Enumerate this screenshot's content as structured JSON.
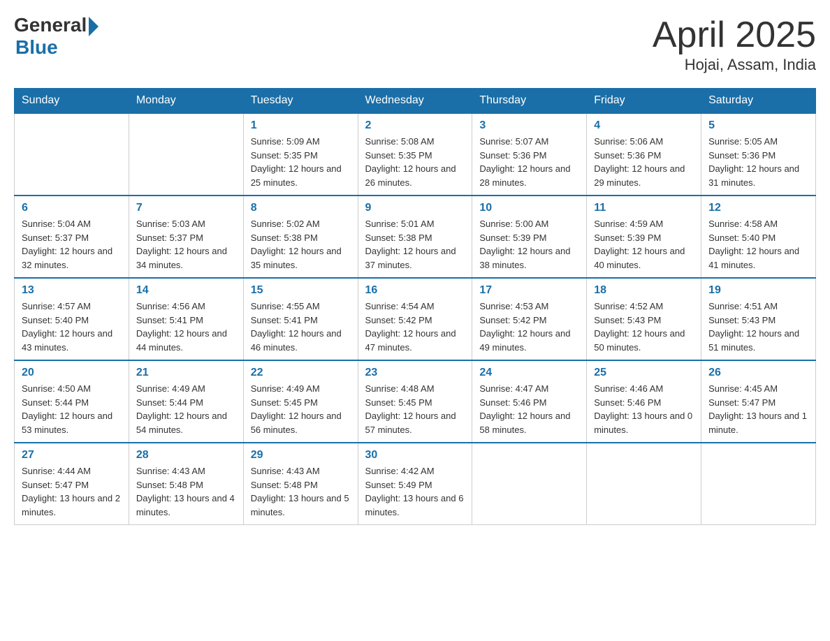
{
  "header": {
    "logo_general": "General",
    "logo_blue": "Blue",
    "title": "April 2025",
    "subtitle": "Hojai, Assam, India"
  },
  "days_of_week": [
    "Sunday",
    "Monday",
    "Tuesday",
    "Wednesday",
    "Thursday",
    "Friday",
    "Saturday"
  ],
  "weeks": [
    [
      {
        "day": "",
        "info": ""
      },
      {
        "day": "",
        "info": ""
      },
      {
        "day": "1",
        "info": "Sunrise: 5:09 AM\nSunset: 5:35 PM\nDaylight: 12 hours\nand 25 minutes."
      },
      {
        "day": "2",
        "info": "Sunrise: 5:08 AM\nSunset: 5:35 PM\nDaylight: 12 hours\nand 26 minutes."
      },
      {
        "day": "3",
        "info": "Sunrise: 5:07 AM\nSunset: 5:36 PM\nDaylight: 12 hours\nand 28 minutes."
      },
      {
        "day": "4",
        "info": "Sunrise: 5:06 AM\nSunset: 5:36 PM\nDaylight: 12 hours\nand 29 minutes."
      },
      {
        "day": "5",
        "info": "Sunrise: 5:05 AM\nSunset: 5:36 PM\nDaylight: 12 hours\nand 31 minutes."
      }
    ],
    [
      {
        "day": "6",
        "info": "Sunrise: 5:04 AM\nSunset: 5:37 PM\nDaylight: 12 hours\nand 32 minutes."
      },
      {
        "day": "7",
        "info": "Sunrise: 5:03 AM\nSunset: 5:37 PM\nDaylight: 12 hours\nand 34 minutes."
      },
      {
        "day": "8",
        "info": "Sunrise: 5:02 AM\nSunset: 5:38 PM\nDaylight: 12 hours\nand 35 minutes."
      },
      {
        "day": "9",
        "info": "Sunrise: 5:01 AM\nSunset: 5:38 PM\nDaylight: 12 hours\nand 37 minutes."
      },
      {
        "day": "10",
        "info": "Sunrise: 5:00 AM\nSunset: 5:39 PM\nDaylight: 12 hours\nand 38 minutes."
      },
      {
        "day": "11",
        "info": "Sunrise: 4:59 AM\nSunset: 5:39 PM\nDaylight: 12 hours\nand 40 minutes."
      },
      {
        "day": "12",
        "info": "Sunrise: 4:58 AM\nSunset: 5:40 PM\nDaylight: 12 hours\nand 41 minutes."
      }
    ],
    [
      {
        "day": "13",
        "info": "Sunrise: 4:57 AM\nSunset: 5:40 PM\nDaylight: 12 hours\nand 43 minutes."
      },
      {
        "day": "14",
        "info": "Sunrise: 4:56 AM\nSunset: 5:41 PM\nDaylight: 12 hours\nand 44 minutes."
      },
      {
        "day": "15",
        "info": "Sunrise: 4:55 AM\nSunset: 5:41 PM\nDaylight: 12 hours\nand 46 minutes."
      },
      {
        "day": "16",
        "info": "Sunrise: 4:54 AM\nSunset: 5:42 PM\nDaylight: 12 hours\nand 47 minutes."
      },
      {
        "day": "17",
        "info": "Sunrise: 4:53 AM\nSunset: 5:42 PM\nDaylight: 12 hours\nand 49 minutes."
      },
      {
        "day": "18",
        "info": "Sunrise: 4:52 AM\nSunset: 5:43 PM\nDaylight: 12 hours\nand 50 minutes."
      },
      {
        "day": "19",
        "info": "Sunrise: 4:51 AM\nSunset: 5:43 PM\nDaylight: 12 hours\nand 51 minutes."
      }
    ],
    [
      {
        "day": "20",
        "info": "Sunrise: 4:50 AM\nSunset: 5:44 PM\nDaylight: 12 hours\nand 53 minutes."
      },
      {
        "day": "21",
        "info": "Sunrise: 4:49 AM\nSunset: 5:44 PM\nDaylight: 12 hours\nand 54 minutes."
      },
      {
        "day": "22",
        "info": "Sunrise: 4:49 AM\nSunset: 5:45 PM\nDaylight: 12 hours\nand 56 minutes."
      },
      {
        "day": "23",
        "info": "Sunrise: 4:48 AM\nSunset: 5:45 PM\nDaylight: 12 hours\nand 57 minutes."
      },
      {
        "day": "24",
        "info": "Sunrise: 4:47 AM\nSunset: 5:46 PM\nDaylight: 12 hours\nand 58 minutes."
      },
      {
        "day": "25",
        "info": "Sunrise: 4:46 AM\nSunset: 5:46 PM\nDaylight: 13 hours\nand 0 minutes."
      },
      {
        "day": "26",
        "info": "Sunrise: 4:45 AM\nSunset: 5:47 PM\nDaylight: 13 hours\nand 1 minute."
      }
    ],
    [
      {
        "day": "27",
        "info": "Sunrise: 4:44 AM\nSunset: 5:47 PM\nDaylight: 13 hours\nand 2 minutes."
      },
      {
        "day": "28",
        "info": "Sunrise: 4:43 AM\nSunset: 5:48 PM\nDaylight: 13 hours\nand 4 minutes."
      },
      {
        "day": "29",
        "info": "Sunrise: 4:43 AM\nSunset: 5:48 PM\nDaylight: 13 hours\nand 5 minutes."
      },
      {
        "day": "30",
        "info": "Sunrise: 4:42 AM\nSunset: 5:49 PM\nDaylight: 13 hours\nand 6 minutes."
      },
      {
        "day": "",
        "info": ""
      },
      {
        "day": "",
        "info": ""
      },
      {
        "day": "",
        "info": ""
      }
    ]
  ]
}
